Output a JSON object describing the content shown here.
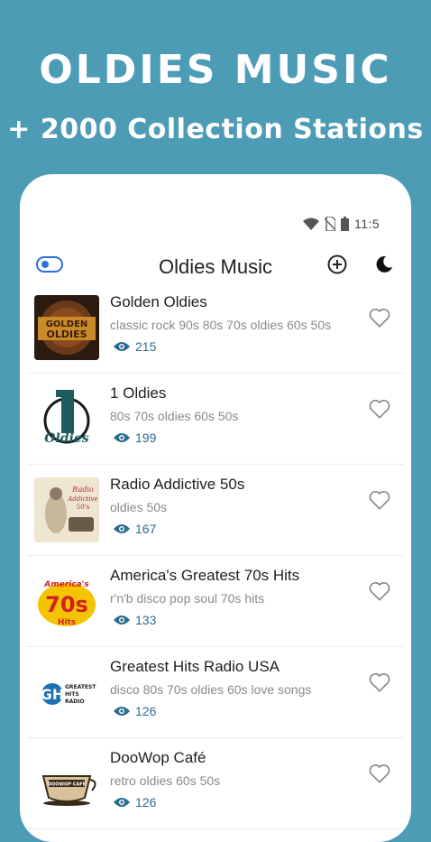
{
  "promo": {
    "title": "OLDIES MUSIC",
    "subtitle": "+ 2000 Collection Stations"
  },
  "status_bar": {
    "time": "11:5"
  },
  "app_bar": {
    "title": "Oldies Music",
    "toggle_icon": "toggle-icon",
    "add_icon": "add-circle-icon",
    "theme_icon": "moon-icon"
  },
  "stations": [
    {
      "name": "Golden Oldies",
      "tags": "classic rock 90s 80s 70s oldies 60s 50s",
      "views": "215",
      "logo_text": "GOLDEN OLDIES"
    },
    {
      "name": "1 Oldies",
      "tags": "80s 70s oldies 60s 50s",
      "views": "199",
      "logo_text": "1 Oldies"
    },
    {
      "name": "Radio Addictive 50s",
      "tags": "oldies 50s",
      "views": "167",
      "logo_text": "Radio Addictive 50's"
    },
    {
      "name": "America's Greatest 70s Hits",
      "tags": "r'n'b disco pop soul 70s hits",
      "views": "133",
      "logo_text": "America's Greatest 70s Hits"
    },
    {
      "name": "Greatest Hits Radio USA",
      "tags": "disco 80s 70s oldies 60s love songs",
      "views": "126",
      "logo_text": "GREATEST HITS RADIO"
    },
    {
      "name": "DooWop Café",
      "tags": "retro oldies 60s 50s",
      "views": "126",
      "logo_text": "DOOWOP CAFE"
    }
  ],
  "colors": {
    "background": "#4d9cb6",
    "accent_blue": "#2b6fe0",
    "views_blue": "#2c6c8f"
  }
}
